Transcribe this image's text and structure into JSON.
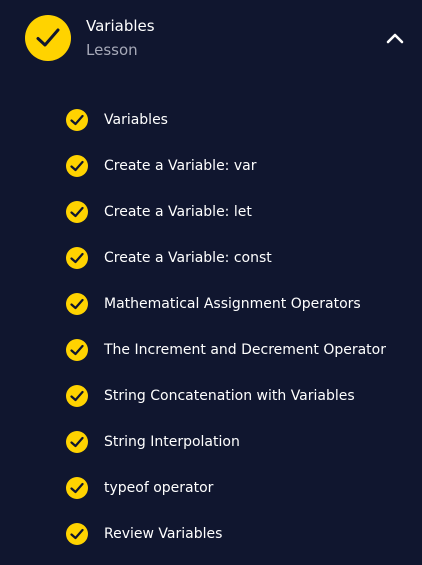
{
  "colors": {
    "background": "#10162f",
    "check_fill": "#ffd300",
    "check_mark": "#10162f",
    "title_text": "#ffffff",
    "subtitle_text": "#a6a9b8"
  },
  "header": {
    "title": "Variables",
    "subtitle": "Lesson",
    "status_icon": "check-circle-icon",
    "toggle_icon": "chevron-up-icon"
  },
  "items": [
    {
      "label": "Variables",
      "icon": "check-circle-icon"
    },
    {
      "label": "Create a Variable: var",
      "icon": "check-circle-icon"
    },
    {
      "label": "Create a Variable: let",
      "icon": "check-circle-icon"
    },
    {
      "label": "Create a Variable: const",
      "icon": "check-circle-icon"
    },
    {
      "label": "Mathematical Assignment Operators",
      "icon": "check-circle-icon"
    },
    {
      "label": "The Increment and Decrement Operator",
      "icon": "check-circle-icon"
    },
    {
      "label": "String Concatenation with Variables",
      "icon": "check-circle-icon"
    },
    {
      "label": "String Interpolation",
      "icon": "check-circle-icon"
    },
    {
      "label": "typeof operator",
      "icon": "check-circle-icon"
    },
    {
      "label": "Review Variables",
      "icon": "check-circle-icon"
    }
  ]
}
